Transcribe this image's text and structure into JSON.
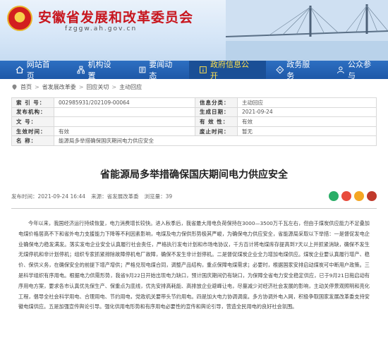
{
  "site": {
    "title": "安徽省发展和改革委员会",
    "url": "fzggw.ah.gov.cn"
  },
  "nav": [
    {
      "label": "网站首页",
      "icon": "home-icon",
      "active": false
    },
    {
      "label": "机构设置",
      "icon": "org-icon",
      "active": false
    },
    {
      "label": "要闻动态",
      "icon": "news-icon",
      "active": false
    },
    {
      "label": "政府信息公开",
      "icon": "info-icon",
      "active": true
    },
    {
      "label": "政务服务",
      "icon": "service-icon",
      "active": false
    },
    {
      "label": "公众参与",
      "icon": "people-icon",
      "active": false
    }
  ],
  "breadcrumb": [
    "首页",
    "省发展改革委",
    "回应关切",
    "主动回应"
  ],
  "meta": {
    "index_label": "索 引 号：",
    "index_value": "002985931/202109-00064",
    "category_label": "信息分类：",
    "category_value": "主动回应",
    "issuer_label": "发布机构：",
    "issuer_value": "",
    "date_label": "生成日期：",
    "date_value": "2021-09-24",
    "docno_label": "文 号：",
    "docno_value": "",
    "valid_label": "有 效 性：",
    "valid_value": "有效",
    "effective_label": "生效时间：",
    "effective_value": "有效",
    "expire_label": "废止时间：",
    "expire_value": "暂无",
    "name_label": "名 称：",
    "name_value": "能源局多举措确保国庆期间电力供应安全"
  },
  "article": {
    "title": "省能源局多举措确保国庆期间电力供应安全",
    "publish_time": "发布时间：2021-09-24 16:44",
    "source": "来源：省发展改革委",
    "views": "浏览量：39",
    "body": "今年以来，我国经济运行持续恢复，电力消费增长较快。进入秋季后，我省最大用电负荷保持在3000—3500万千瓦左右，但由于煤炭供应能力不足叠加电煤价格居高不下和省外电力支援能力下降等不利因素影响，电煤及电力保供形势极其严峻，为确保电力供应安全，省能源局采取以下举措：一是督促发电企业确保电力稳发满发。落实发电企业安全认真履行社会责任，严格执行发电计划和市场电协议，千方百计将电煤库存提高到7天以上并抓紧消缺，确保不发生无煤停机和非计划停机；组织专家抓紧排除故障停机电厂故障，确保不发生非计划停机。二是督促煤炭企业全力增加电煤供应。煤炭企业要认真履行增产、稳价、保供义务，在确保安全的前提下增产增供；严格兑现电煤合同，调整产品结构，重点保障电煤需求；必要时，根据国家安排启动煤炭可中断用户政策。三是科学组织有序用电。根据电力供需形势，我省9月22日开始出现电力缺口，预计国庆期间仍有缺口，为保障全省电力安全稳定供应，已于9月21日拖启动有序用电方案，要求各市认真优先保生产、保重点为底线，优先安排高耗能、高排放企业避峰让电，尽量减少对经济社会发展的影响，主动关停景观照明和亮化工程，倡导全社会科学用电、合理用电、节约用电，党政机关要带头节约用电。四是加大电力协调调度。多方协调外电入网，积极争取国家发展改革委支持安徽电煤供应。五是加强宣传舆论引导。强化供用电形势和有序用电必要性的宣传和舆论引导，营造全民用电的良好社会氛围。"
  }
}
